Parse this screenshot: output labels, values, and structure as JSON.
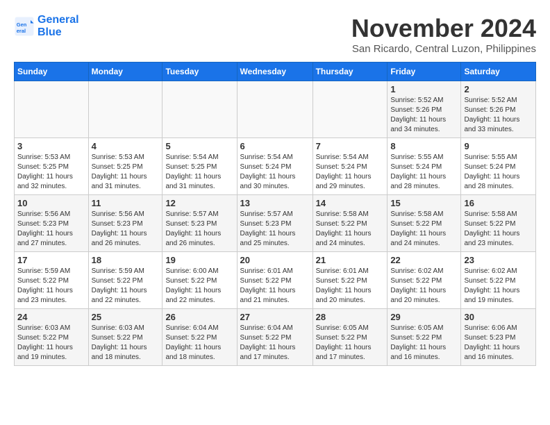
{
  "logo": {
    "line1": "General",
    "line2": "Blue"
  },
  "title": "November 2024",
  "subtitle": "San Ricardo, Central Luzon, Philippines",
  "headers": [
    "Sunday",
    "Monday",
    "Tuesday",
    "Wednesday",
    "Thursday",
    "Friday",
    "Saturday"
  ],
  "weeks": [
    [
      {
        "day": "",
        "info": ""
      },
      {
        "day": "",
        "info": ""
      },
      {
        "day": "",
        "info": ""
      },
      {
        "day": "",
        "info": ""
      },
      {
        "day": "",
        "info": ""
      },
      {
        "day": "1",
        "info": "Sunrise: 5:52 AM\nSunset: 5:26 PM\nDaylight: 11 hours\nand 34 minutes."
      },
      {
        "day": "2",
        "info": "Sunrise: 5:52 AM\nSunset: 5:26 PM\nDaylight: 11 hours\nand 33 minutes."
      }
    ],
    [
      {
        "day": "3",
        "info": "Sunrise: 5:53 AM\nSunset: 5:25 PM\nDaylight: 11 hours\nand 32 minutes."
      },
      {
        "day": "4",
        "info": "Sunrise: 5:53 AM\nSunset: 5:25 PM\nDaylight: 11 hours\nand 31 minutes."
      },
      {
        "day": "5",
        "info": "Sunrise: 5:54 AM\nSunset: 5:25 PM\nDaylight: 11 hours\nand 31 minutes."
      },
      {
        "day": "6",
        "info": "Sunrise: 5:54 AM\nSunset: 5:24 PM\nDaylight: 11 hours\nand 30 minutes."
      },
      {
        "day": "7",
        "info": "Sunrise: 5:54 AM\nSunset: 5:24 PM\nDaylight: 11 hours\nand 29 minutes."
      },
      {
        "day": "8",
        "info": "Sunrise: 5:55 AM\nSunset: 5:24 PM\nDaylight: 11 hours\nand 28 minutes."
      },
      {
        "day": "9",
        "info": "Sunrise: 5:55 AM\nSunset: 5:24 PM\nDaylight: 11 hours\nand 28 minutes."
      }
    ],
    [
      {
        "day": "10",
        "info": "Sunrise: 5:56 AM\nSunset: 5:23 PM\nDaylight: 11 hours\nand 27 minutes."
      },
      {
        "day": "11",
        "info": "Sunrise: 5:56 AM\nSunset: 5:23 PM\nDaylight: 11 hours\nand 26 minutes."
      },
      {
        "day": "12",
        "info": "Sunrise: 5:57 AM\nSunset: 5:23 PM\nDaylight: 11 hours\nand 26 minutes."
      },
      {
        "day": "13",
        "info": "Sunrise: 5:57 AM\nSunset: 5:23 PM\nDaylight: 11 hours\nand 25 minutes."
      },
      {
        "day": "14",
        "info": "Sunrise: 5:58 AM\nSunset: 5:22 PM\nDaylight: 11 hours\nand 24 minutes."
      },
      {
        "day": "15",
        "info": "Sunrise: 5:58 AM\nSunset: 5:22 PM\nDaylight: 11 hours\nand 24 minutes."
      },
      {
        "day": "16",
        "info": "Sunrise: 5:58 AM\nSunset: 5:22 PM\nDaylight: 11 hours\nand 23 minutes."
      }
    ],
    [
      {
        "day": "17",
        "info": "Sunrise: 5:59 AM\nSunset: 5:22 PM\nDaylight: 11 hours\nand 23 minutes."
      },
      {
        "day": "18",
        "info": "Sunrise: 5:59 AM\nSunset: 5:22 PM\nDaylight: 11 hours\nand 22 minutes."
      },
      {
        "day": "19",
        "info": "Sunrise: 6:00 AM\nSunset: 5:22 PM\nDaylight: 11 hours\nand 22 minutes."
      },
      {
        "day": "20",
        "info": "Sunrise: 6:01 AM\nSunset: 5:22 PM\nDaylight: 11 hours\nand 21 minutes."
      },
      {
        "day": "21",
        "info": "Sunrise: 6:01 AM\nSunset: 5:22 PM\nDaylight: 11 hours\nand 20 minutes."
      },
      {
        "day": "22",
        "info": "Sunrise: 6:02 AM\nSunset: 5:22 PM\nDaylight: 11 hours\nand 20 minutes."
      },
      {
        "day": "23",
        "info": "Sunrise: 6:02 AM\nSunset: 5:22 PM\nDaylight: 11 hours\nand 19 minutes."
      }
    ],
    [
      {
        "day": "24",
        "info": "Sunrise: 6:03 AM\nSunset: 5:22 PM\nDaylight: 11 hours\nand 19 minutes."
      },
      {
        "day": "25",
        "info": "Sunrise: 6:03 AM\nSunset: 5:22 PM\nDaylight: 11 hours\nand 18 minutes."
      },
      {
        "day": "26",
        "info": "Sunrise: 6:04 AM\nSunset: 5:22 PM\nDaylight: 11 hours\nand 18 minutes."
      },
      {
        "day": "27",
        "info": "Sunrise: 6:04 AM\nSunset: 5:22 PM\nDaylight: 11 hours\nand 17 minutes."
      },
      {
        "day": "28",
        "info": "Sunrise: 6:05 AM\nSunset: 5:22 PM\nDaylight: 11 hours\nand 17 minutes."
      },
      {
        "day": "29",
        "info": "Sunrise: 6:05 AM\nSunset: 5:22 PM\nDaylight: 11 hours\nand 16 minutes."
      },
      {
        "day": "30",
        "info": "Sunrise: 6:06 AM\nSunset: 5:23 PM\nDaylight: 11 hours\nand 16 minutes."
      }
    ]
  ]
}
